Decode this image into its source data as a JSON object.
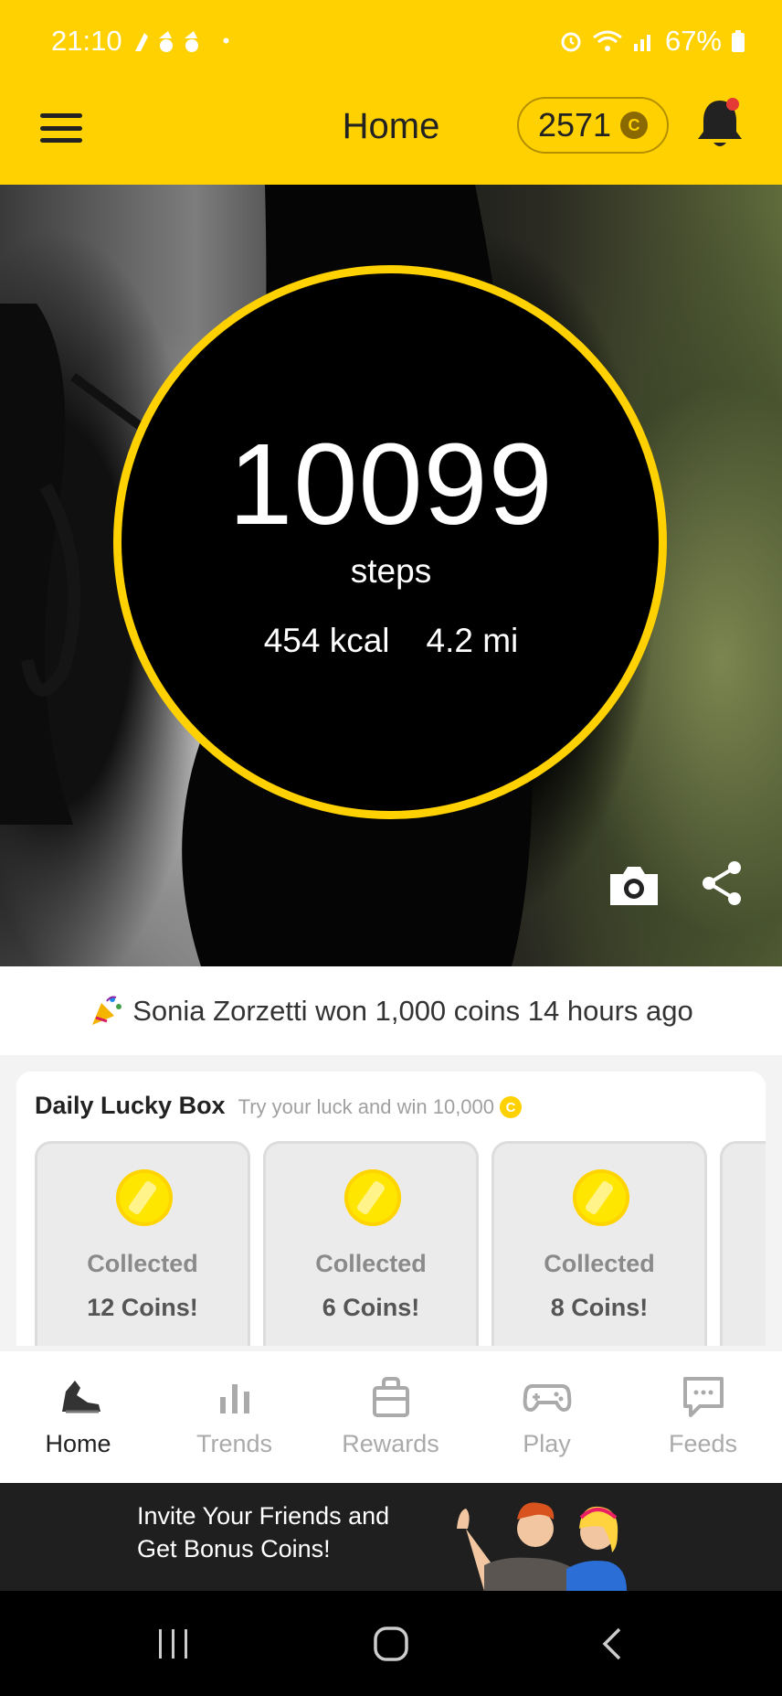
{
  "status_bar": {
    "time": "21:10",
    "battery": "67%"
  },
  "header": {
    "title": "Home",
    "coin_balance": "2571",
    "coin_symbol": "C"
  },
  "hero": {
    "steps": "10099",
    "steps_label": "steps",
    "kcal": "454 kcal",
    "distance": "4.2 mi"
  },
  "ticker": {
    "message": "Sonia Zorzetti won 1,000 coins 14 hours ago"
  },
  "lucky_box": {
    "title": "Daily Lucky Box",
    "subtitle": "Try your luck and win 10,000",
    "coin_symbol": "C",
    "boxes": [
      {
        "status": "Collected",
        "amount": "12 Coins!"
      },
      {
        "status": "Collected",
        "amount": "6 Coins!"
      },
      {
        "status": "Collected",
        "amount": "8 Coins!"
      }
    ]
  },
  "nav": {
    "items": [
      {
        "label": "Home",
        "icon": "shoe-icon",
        "active": true
      },
      {
        "label": "Trends",
        "icon": "bar-chart-icon"
      },
      {
        "label": "Rewards",
        "icon": "shopping-bag-icon"
      },
      {
        "label": "Play",
        "icon": "gamepad-icon"
      },
      {
        "label": "Feeds",
        "icon": "chat-bubble-icon"
      }
    ]
  },
  "banner": {
    "text_line1": "Invite Your Friends and",
    "text_line2": "Get Bonus Coins!"
  },
  "colors": {
    "accent": "#FFD100",
    "dark": "#1f1f1f"
  }
}
